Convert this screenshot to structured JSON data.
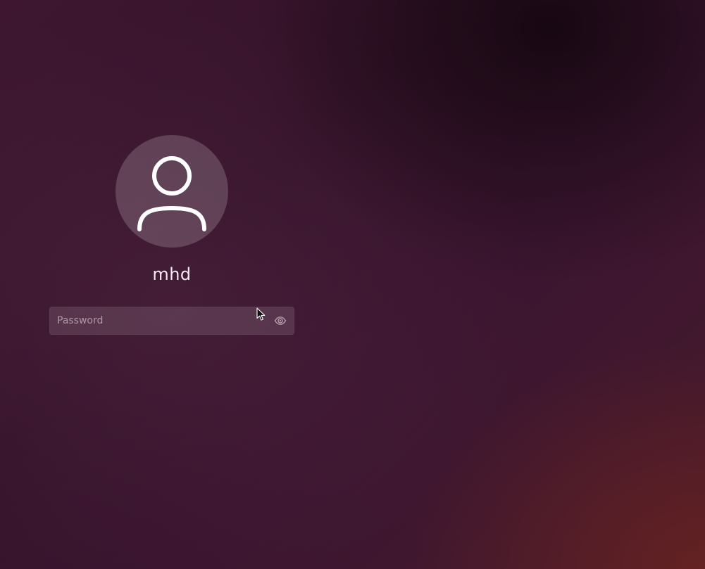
{
  "login": {
    "username": "mhd",
    "password": {
      "value": "",
      "placeholder": "Password"
    }
  },
  "icons": {
    "avatar": "user-silhouette-icon",
    "reveal": "eye-icon",
    "pointer": "mouse-pointer-icon"
  },
  "colors": {
    "background": "#3b1530",
    "text": "#f2eaf0"
  }
}
